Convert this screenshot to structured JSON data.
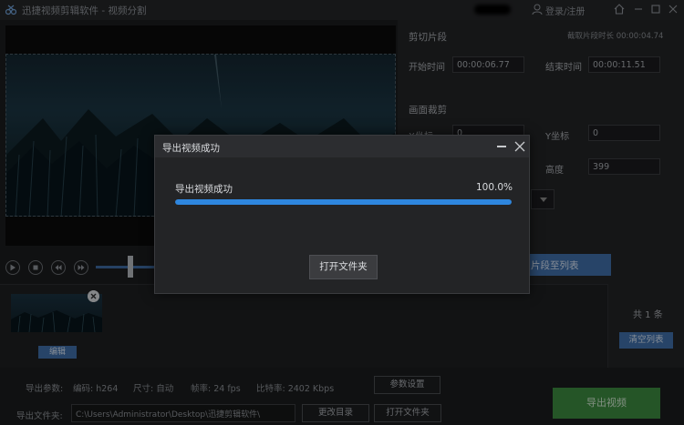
{
  "window": {
    "title": "迅捷视频剪辑软件 - 视频分割",
    "login_label": "登录/注册"
  },
  "clip": {
    "section_title": "剪切片段",
    "duration_label": "截取片段时长 00:00:04.74",
    "start_label": "开始时间",
    "start_value": "00:00:06.77",
    "end_label": "结束时间",
    "end_value": "00:00:11.51"
  },
  "crop": {
    "section_title": "画面裁剪",
    "x_label": "X坐标",
    "x_value": "0",
    "y_label": "Y坐标",
    "y_value": "0",
    "height_label": "高度",
    "height_value": "399"
  },
  "add_to_list_label": "片段至列表",
  "clip_list": {
    "edit_label": "编辑",
    "count_text": "共 1 条",
    "clear_label": "清空列表"
  },
  "export": {
    "params_label": "导出参数:",
    "codec": "编码: h264",
    "size": "尺寸: 自动",
    "fps": "帧率: 24 fps",
    "bitrate": "比特率: 2402 Kbps",
    "settings_label": "参数设置",
    "folder_label": "导出文件夹:",
    "folder_path": "C:\\Users\\Administrator\\Desktop\\迅捷剪辑软件\\",
    "change_dir_label": "更改目录",
    "open_folder_label": "打开文件夹",
    "export_label": "导出视频"
  },
  "dialog": {
    "title": "导出视频成功",
    "status_text": "导出视频成功",
    "percent_text": "100.0%",
    "progress": 1.0,
    "open_folder_label": "打开文件夹"
  },
  "colors": {
    "accent_blue": "#3f6ea8",
    "progress_blue": "#2e86de",
    "export_green": "#3d8a3f"
  }
}
